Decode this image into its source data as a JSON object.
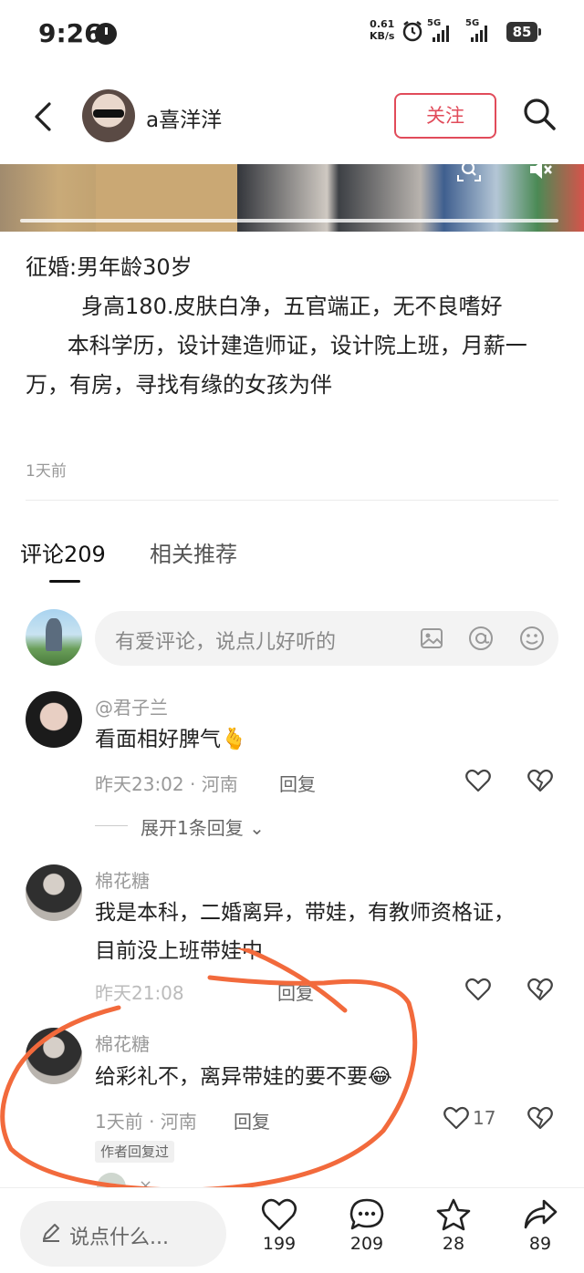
{
  "status_bar": {
    "time": "9:26",
    "net_speed_value": "0.61",
    "net_speed_unit": "KB/s",
    "signal1": "5G",
    "signal2": "5G",
    "battery": "85"
  },
  "header": {
    "author_name": "a喜洋洋",
    "follow_label": "关注"
  },
  "post": {
    "lines": [
      "征婚:男年龄30岁",
      "        身高180.皮肤白净，五官端正，无不良嗜好",
      "      本科学历，设计建造师证，设计院上班，月薪一万，有房，寻找有缘的女孩为伴"
    ],
    "time": "1天前"
  },
  "tabs": {
    "comments": "评论209",
    "related": "相关推荐"
  },
  "comment_input": {
    "placeholder": "有爱评论，说点儿好听的"
  },
  "comments": [
    {
      "user": "@君子兰",
      "text": "看面相好脾气",
      "emoji": "🫰",
      "time": "昨天23:02 · 河南",
      "reply": "回复",
      "expand": "展开1条回复"
    },
    {
      "user": "棉花糖",
      "text": "我是本科，二婚离异，带娃，有教师资格证，目前没上班带娃中",
      "time": "昨天21:08",
      "reply": "回复"
    },
    {
      "user": "棉花糖",
      "text": "给彩礼不，离异带娃的要不要",
      "emoji": "😂",
      "time": "1天前 · 河南",
      "reply": "回复",
      "likes": "17",
      "author_tag": "作者回复过"
    }
  ],
  "bottom_bar": {
    "say_placeholder": "说点什么...",
    "likes": "199",
    "comments": "209",
    "favorites": "28",
    "shares": "89"
  },
  "colors": {
    "accent": "#e14b5a",
    "annotation": "#f26a3c"
  }
}
